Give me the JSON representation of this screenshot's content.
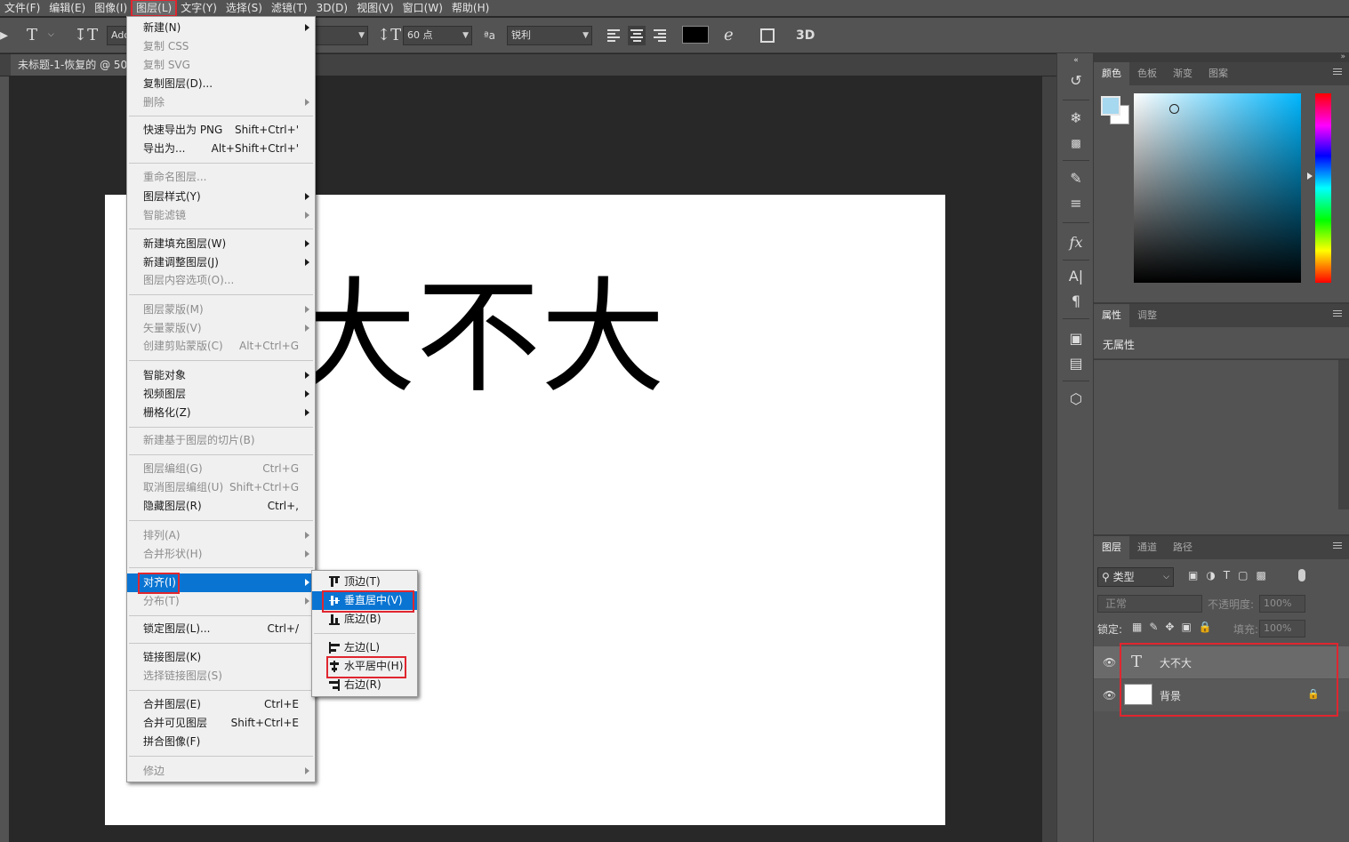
{
  "menubar": {
    "items": [
      "文件(F)",
      "编辑(E)",
      "图像(I)",
      "图层(L)",
      "文字(Y)",
      "选择(S)",
      "滤镜(T)",
      "3D(D)",
      "视图(V)",
      "窗口(W)",
      "帮助(H)"
    ]
  },
  "options": {
    "font_field": "Ado",
    "font_size": "60 点",
    "aa_icon": "ªa",
    "antialias": "锐利",
    "threed_label": "3D"
  },
  "document": {
    "tab_title": "未标题-1-恢复的 @ 50%",
    "canvas_text": "大不大"
  },
  "layer_menu": {
    "new": "新建(N)",
    "copy_css": "复制 CSS",
    "copy_svg": "复制 SVG",
    "duplicate": "复制图层(D)...",
    "delete": "删除",
    "quick_export": "快速导出为 PNG",
    "quick_export_sc": "Shift+Ctrl+'",
    "export_as": "导出为...",
    "export_as_sc": "Alt+Shift+Ctrl+'",
    "rename": "重命名图层...",
    "layer_style": "图层样式(Y)",
    "smart_filter": "智能滤镜",
    "new_fill": "新建填充图层(W)",
    "new_adjust": "新建调整图层(J)",
    "content_options": "图层内容选项(O)...",
    "layer_mask": "图层蒙版(M)",
    "vector_mask": "矢量蒙版(V)",
    "clip_mask": "创建剪贴蒙版(C)",
    "clip_mask_sc": "Alt+Ctrl+G",
    "smart_object": "智能对象",
    "video_layer": "视频图层",
    "rasterize": "栅格化(Z)",
    "new_slice": "新建基于图层的切片(B)",
    "group": "图层编组(G)",
    "group_sc": "Ctrl+G",
    "ungroup": "取消图层编组(U)",
    "ungroup_sc": "Shift+Ctrl+G",
    "hide": "隐藏图层(R)",
    "hide_sc": "Ctrl+,",
    "arrange": "排列(A)",
    "combine_shapes": "合并形状(H)",
    "align": "对齐(I)",
    "distribute": "分布(T)",
    "lock": "锁定图层(L)...",
    "lock_sc": "Ctrl+/",
    "link": "链接图层(K)",
    "select_linked": "选择链接图层(S)",
    "merge": "合并图层(E)",
    "merge_sc": "Ctrl+E",
    "merge_visible": "合并可见图层",
    "merge_visible_sc": "Shift+Ctrl+E",
    "flatten": "拼合图像(F)",
    "matting": "修边"
  },
  "align_submenu": {
    "top": "顶边(T)",
    "vcenter": "垂直居中(V)",
    "bottom": "底边(B)",
    "left": "左边(L)",
    "hcenter": "水平居中(H)",
    "right": "右边(R)"
  },
  "color_panel": {
    "tabs": [
      "颜色",
      "色板",
      "渐变",
      "图案"
    ],
    "foreground": "#a6d8f0",
    "background": "#ffffff"
  },
  "properties_panel": {
    "tabs": [
      "属性",
      "调整"
    ],
    "empty_text": "无属性"
  },
  "layers_panel": {
    "tabs": [
      "图层",
      "通道",
      "路径"
    ],
    "filter_label": "类型",
    "blend_mode": "正常",
    "opacity_label": "不透明度:",
    "opacity_value": "100%",
    "lock_label": "锁定:",
    "fill_label": "填充:",
    "fill_value": "100%",
    "layers": [
      {
        "name": "大不大",
        "kind": "text"
      },
      {
        "name": "背景",
        "kind": "image"
      }
    ]
  }
}
